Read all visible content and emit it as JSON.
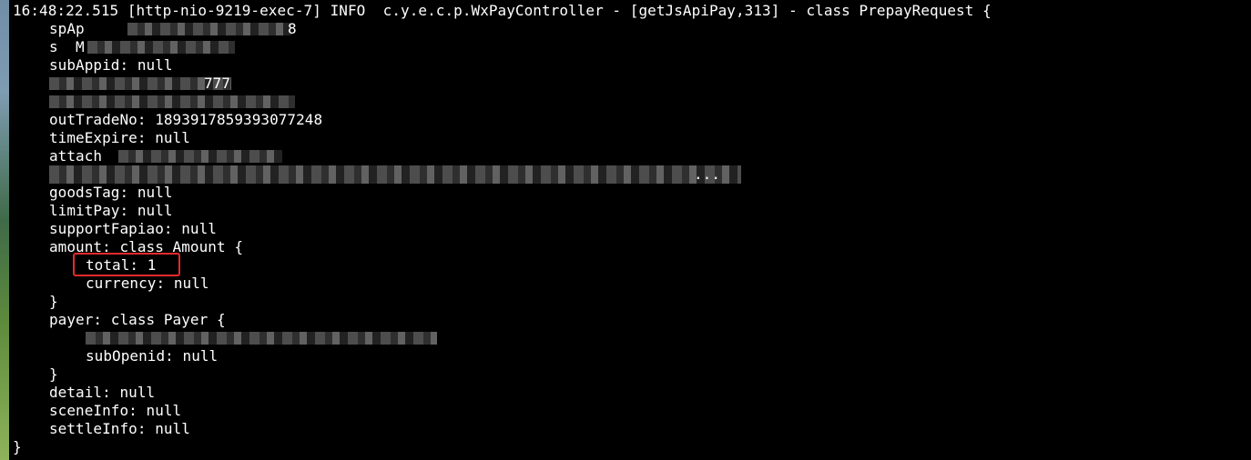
{
  "log": {
    "header": "16:48:22.515 [http-nio-9219-exec-7] INFO  c.y.e.c.p.WxPayController - [getJsApiPay,313] - class PrepayRequest {",
    "partial_1": "spAp",
    "partial_1b": "8",
    "partial_2": "s  M",
    "subAppid": "subAppid: null",
    "partial_3b": "777",
    "outTradeNo": "outTradeNo: 1893917859393077248",
    "timeExpire": "timeExpire: null",
    "partial_7": "attach",
    "partial_7b": "...",
    "goodsTag": "goodsTag: null",
    "limitPay": "limitPay: null",
    "supportFapiao": "supportFapiao: null",
    "amount_open": "amount: class Amount {",
    "total": "total: 1",
    "currency": "currency: null",
    "close_amount": "}",
    "payer_open": "payer: class Payer {",
    "subOpenid": "subOpenid: null",
    "close_payer": "}",
    "detail": "detail: null",
    "sceneInfo": "sceneInfo: null",
    "settleInfo": "settleInfo: null",
    "close_request": "}"
  },
  "colors": {
    "background": "#000000",
    "text": "#ffffff",
    "highlight": "#e32b2b"
  }
}
